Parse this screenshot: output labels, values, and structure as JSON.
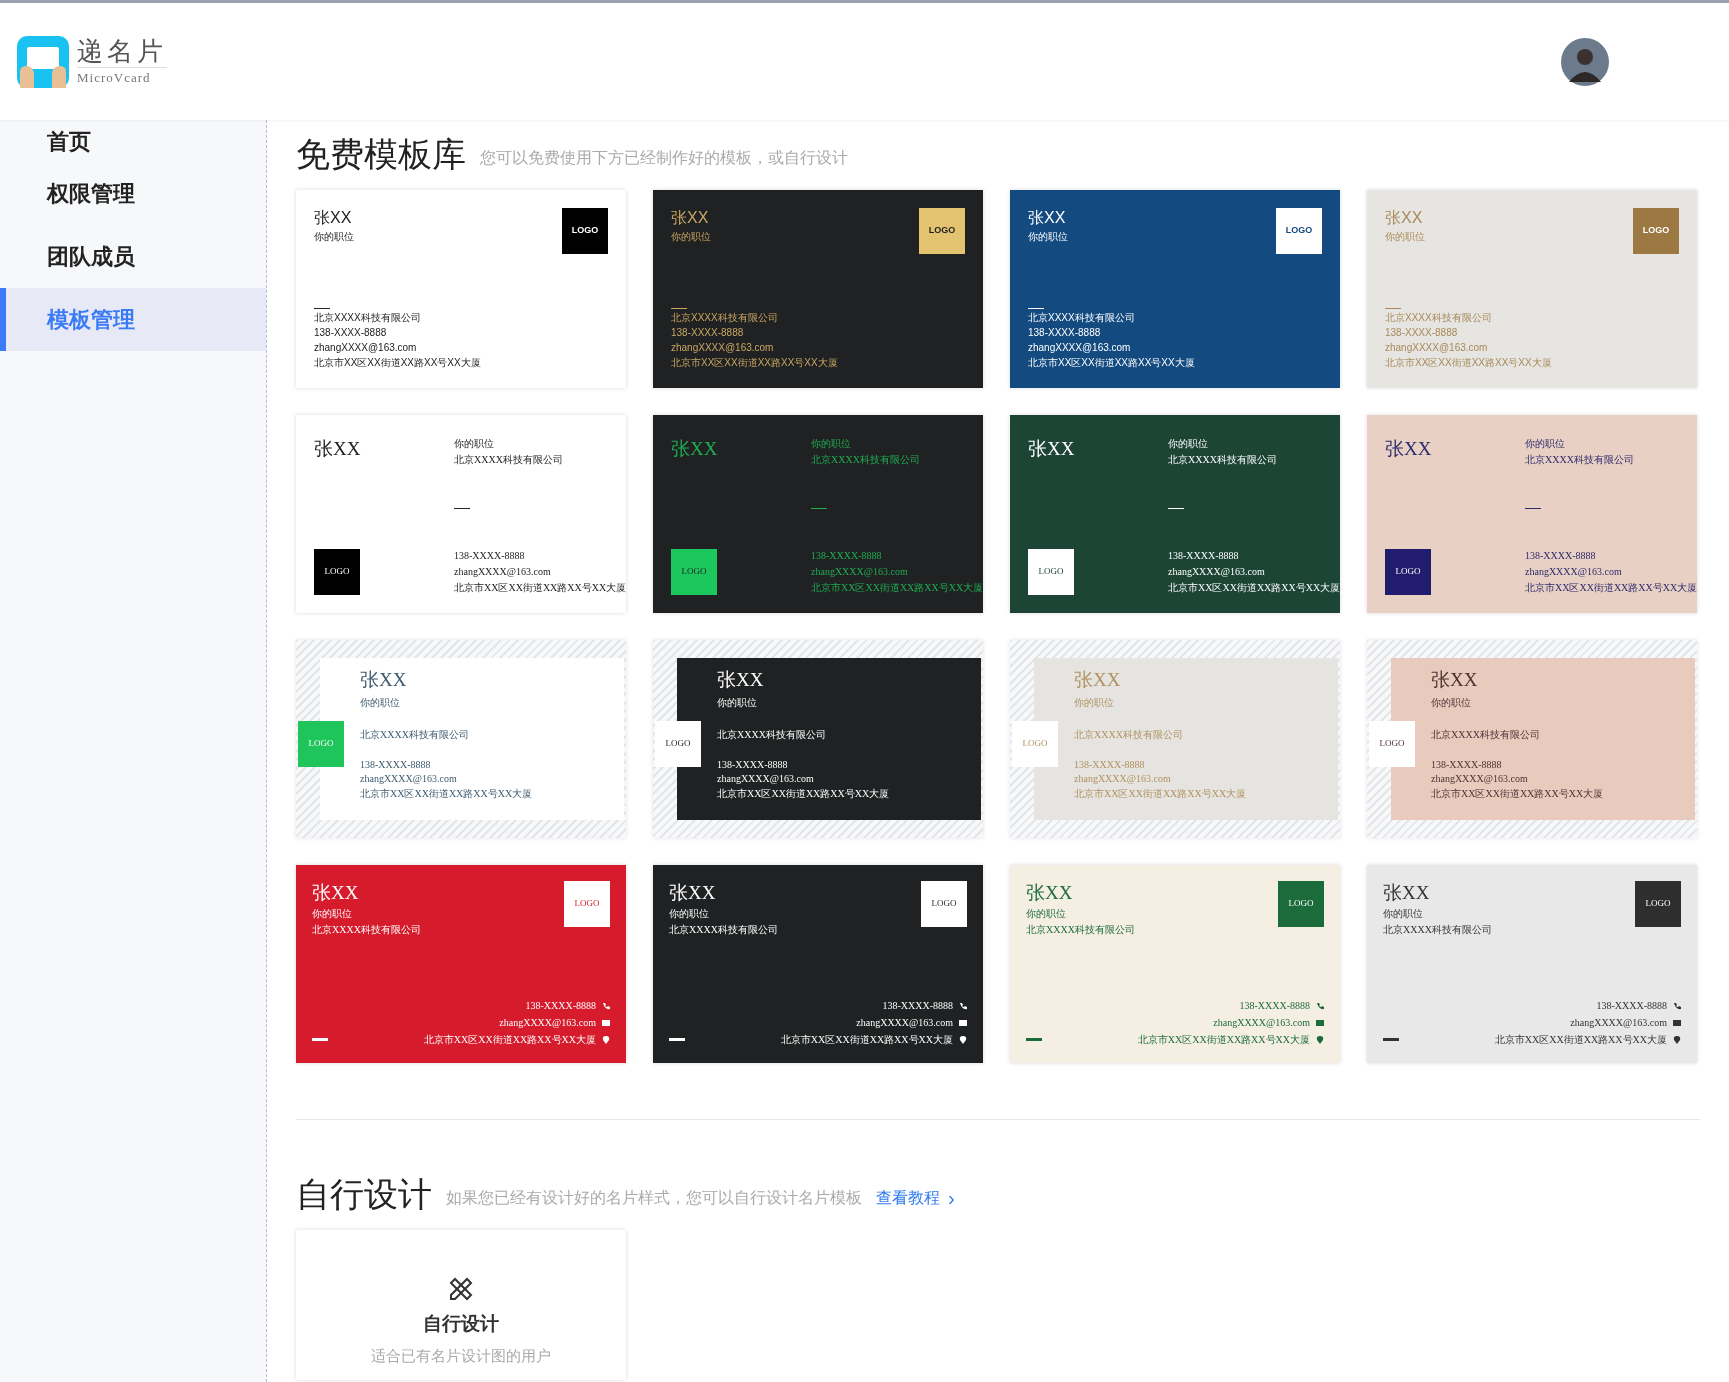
{
  "header": {
    "logo_title": "递名片",
    "logo_subtitle": "MicroVcard"
  },
  "sidebar": {
    "items": [
      {
        "label": "首页",
        "selected": false
      },
      {
        "label": "权限管理",
        "selected": false
      },
      {
        "label": "团队成员",
        "selected": false
      },
      {
        "label": "模板管理",
        "selected": true
      }
    ]
  },
  "free_templates": {
    "title": "免费模板库",
    "subtitle": "您可以免费使用下方已经制作好的模板，或自行设计",
    "cards": [
      {
        "kind": "classic",
        "color": "#ffffff",
        "accent": {
          "color": "#222222"
        },
        "logo": {
          "text": "LOGO",
          "color": "#000000"
        },
        "name": "张XX",
        "title": "你的职位",
        "company": "北京XXXX科技有限公司",
        "phone": "138-XXXX-8888",
        "email": "zhangXXXX@163.com",
        "address": "北京市XX区XX街道XX路XX号XX大厦"
      },
      {
        "kind": "classic",
        "color": "#1f2122",
        "accent": {
          "color": "#c9a862"
        },
        "logo": {
          "text": "LOGO",
          "color": "#e3c270"
        },
        "name": "张XX",
        "title": "你的职位",
        "company": "北京XXXX科技有限公司",
        "phone": "138-XXXX-8888",
        "email": "zhangXXXX@163.com",
        "address": "北京市XX区XX街道XX路XX号XX大厦"
      },
      {
        "kind": "classic",
        "color": "#134a80",
        "accent": {
          "color": "#ffffff"
        },
        "logo": {
          "text": "LOGO",
          "color": "#ffffff"
        },
        "name": "张XX",
        "title": "你的职位",
        "company": "北京XXXX科技有限公司",
        "phone": "138-XXXX-8888",
        "email": "zhangXXXX@163.com",
        "address": "北京市XX区XX街道XX路XX号XX大厦"
      },
      {
        "kind": "classic",
        "color": "#e6e5e1",
        "accent": {
          "color": "#a8895a"
        },
        "logo": {
          "text": "LOGO",
          "color": "#9c7842"
        },
        "name": "张XX",
        "title": "你的职位",
        "company": "北京XXXX科技有限公司",
        "phone": "138-XXXX-8888",
        "email": "zhangXXXX@163.com",
        "address": "北京市XX区XX街道XX路XX号XX大厦"
      },
      {
        "kind": "split",
        "color": "#ffffff",
        "accent": {
          "color": "#222222"
        },
        "logo": {
          "text": "LOGO",
          "color": "#000000"
        },
        "name": "张XX",
        "title": "你的职位",
        "company": "北京XXXX科技有限公司",
        "phone": "138-XXXX-8888",
        "email": "zhangXXXX@163.com",
        "address": "北京市XX区XX街道XX路XX号XX大厦"
      },
      {
        "kind": "split",
        "color": "#1f2122",
        "accent": {
          "color": "#1fae52"
        },
        "logo": {
          "text": "LOGO",
          "color": "#1cc85c"
        },
        "name": "张XX",
        "title": "你的职位",
        "company": "北京XXXX科技有限公司",
        "phone": "138-XXXX-8888",
        "email": "zhangXXXX@163.com",
        "address": "北京市XX区XX街道XX路XX号XX大厦"
      },
      {
        "kind": "split",
        "color": "#1d4535",
        "accent": {
          "color": "#ffffff"
        },
        "logo": {
          "text": "LOGO",
          "color": "#ffffff"
        },
        "name": "张XX",
        "title": "你的职位",
        "company": "北京XXXX科技有限公司",
        "phone": "138-XXXX-8888",
        "email": "zhangXXXX@163.com",
        "address": "北京市XX区XX街道XX路XX号XX大厦"
      },
      {
        "kind": "split",
        "color": "#e9d0c4",
        "accent": {
          "color": "#2b2a6b"
        },
        "logo": {
          "text": "LOGO",
          "color": "#221c6e"
        },
        "name": "张XX",
        "title": "你的职位",
        "company": "北京XXXX科技有限公司",
        "phone": "138-XXXX-8888",
        "email": "zhangXXXX@163.com",
        "address": "北京市XX区XX街道XX路XX号XX大厦"
      },
      {
        "kind": "framed",
        "color": "#ffffff",
        "accent": {
          "color": "#3d5a6e"
        },
        "logo": {
          "text": "LOGO",
          "color": "#1dc55a"
        },
        "name": "张XX",
        "title": "你的职位",
        "company": "北京XXXX科技有限公司",
        "phone": "138-XXXX-8888",
        "email": "zhangXXXX@163.com",
        "address": "北京市XX区XX街道XX路XX号XX大厦"
      },
      {
        "kind": "framed",
        "color": "#1f2122",
        "accent": {
          "color": "#ffffff"
        },
        "logo": {
          "text": "LOGO",
          "color": "#ffffff"
        },
        "name": "张XX",
        "title": "你的职位",
        "company": "北京XXXX科技有限公司",
        "phone": "138-XXXX-8888",
        "email": "zhangXXXX@163.com",
        "address": "北京市XX区XX街道XX路XX号XX大厦"
      },
      {
        "kind": "framed",
        "color": "#e5e4e0",
        "accent": {
          "color": "#b2925f"
        },
        "logo": {
          "text": "LOGO",
          "color": "#ffffff"
        },
        "name": "张XX",
        "title": "你的职位",
        "company": "北京XXXX科技有限公司",
        "phone": "138-XXXX-8888",
        "email": "zhangXXXX@163.com",
        "address": "北京市XX区XX街道XX路XX号XX大厦"
      },
      {
        "kind": "framed",
        "color": "#e8cbbd",
        "accent": {
          "color": "#4e3232"
        },
        "logo": {
          "text": "LOGO",
          "color": "#ffffff"
        },
        "name": "张XX",
        "title": "你的职位",
        "company": "北京XXXX科技有限公司",
        "phone": "138-XXXX-8888",
        "email": "zhangXXXX@163.com",
        "address": "北京市XX区XX街道XX路XX号XX大厦"
      },
      {
        "kind": "contact",
        "color": "#d51b2c",
        "accent": {
          "color": "#ffffff"
        },
        "logo": {
          "text": "LOGO",
          "color": "#ffffff"
        },
        "name": "张XX",
        "title": "你的职位",
        "company": "北京XXXX科技有限公司",
        "phone": "138-XXXX-8888",
        "email": "zhangXXXX@163.com",
        "address": "北京市XX区XX街道XX路XX号XX大厦"
      },
      {
        "kind": "contact",
        "color": "#1f2122",
        "accent": {
          "color": "#ffffff"
        },
        "logo": {
          "text": "LOGO",
          "color": "#ffffff"
        },
        "name": "张XX",
        "title": "你的职位",
        "company": "北京XXXX科技有限公司",
        "phone": "138-XXXX-8888",
        "email": "zhangXXXX@163.com",
        "address": "北京市XX区XX街道XX路XX号XX大厦"
      },
      {
        "kind": "contact",
        "color": "#f5efe3",
        "accent": {
          "color": "#1b6b3b"
        },
        "logo": {
          "text": "LOGO",
          "color": "#1b6b3b"
        },
        "name": "张XX",
        "title": "你的职位",
        "company": "北京XXXX科技有限公司",
        "phone": "138-XXXX-8888",
        "email": "zhangXXXX@163.com",
        "address": "北京市XX区XX街道XX路XX号XX大厦"
      },
      {
        "kind": "contact",
        "color": "#e8e8e8",
        "accent": {
          "color": "#333333"
        },
        "logo": {
          "text": "LOGO",
          "color": "#2e2e2e"
        },
        "name": "张XX",
        "title": "你的职位",
        "company": "北京XXXX科技有限公司",
        "phone": "138-XXXX-8888",
        "email": "zhangXXXX@163.com",
        "address": "北京市XX区XX街道XX路XX号XX大厦"
      }
    ]
  },
  "custom_design": {
    "title": "自行设计",
    "subtitle": "如果您已经有设计好的名片样式，您可以自行设计名片模板",
    "link": "查看教程",
    "link_arrow": "›",
    "card": {
      "title": "自行设计",
      "description": "适合已有名片设计图的用户"
    }
  }
}
